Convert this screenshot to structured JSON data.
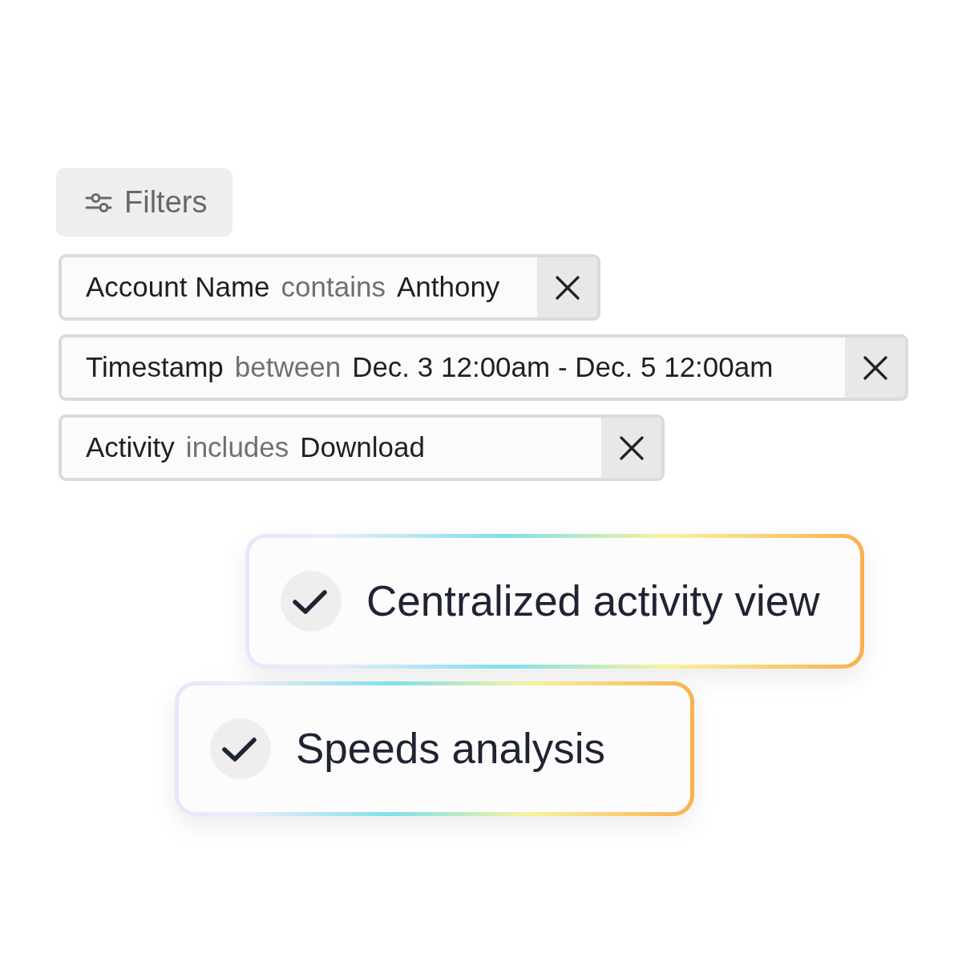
{
  "filters_button": {
    "label": "Filters"
  },
  "filters": [
    {
      "field": "Account Name",
      "operator": "contains",
      "value": "Anthony"
    },
    {
      "field": "Timestamp",
      "operator": "between",
      "value": "Dec. 3 12:00am - Dec. 5 12:00am"
    },
    {
      "field": "Activity",
      "operator": "includes",
      "value": "Download"
    }
  ],
  "features": [
    {
      "label": "Centralized activity view",
      "checked": true
    },
    {
      "label": "Speeds analysis",
      "checked": true
    }
  ]
}
